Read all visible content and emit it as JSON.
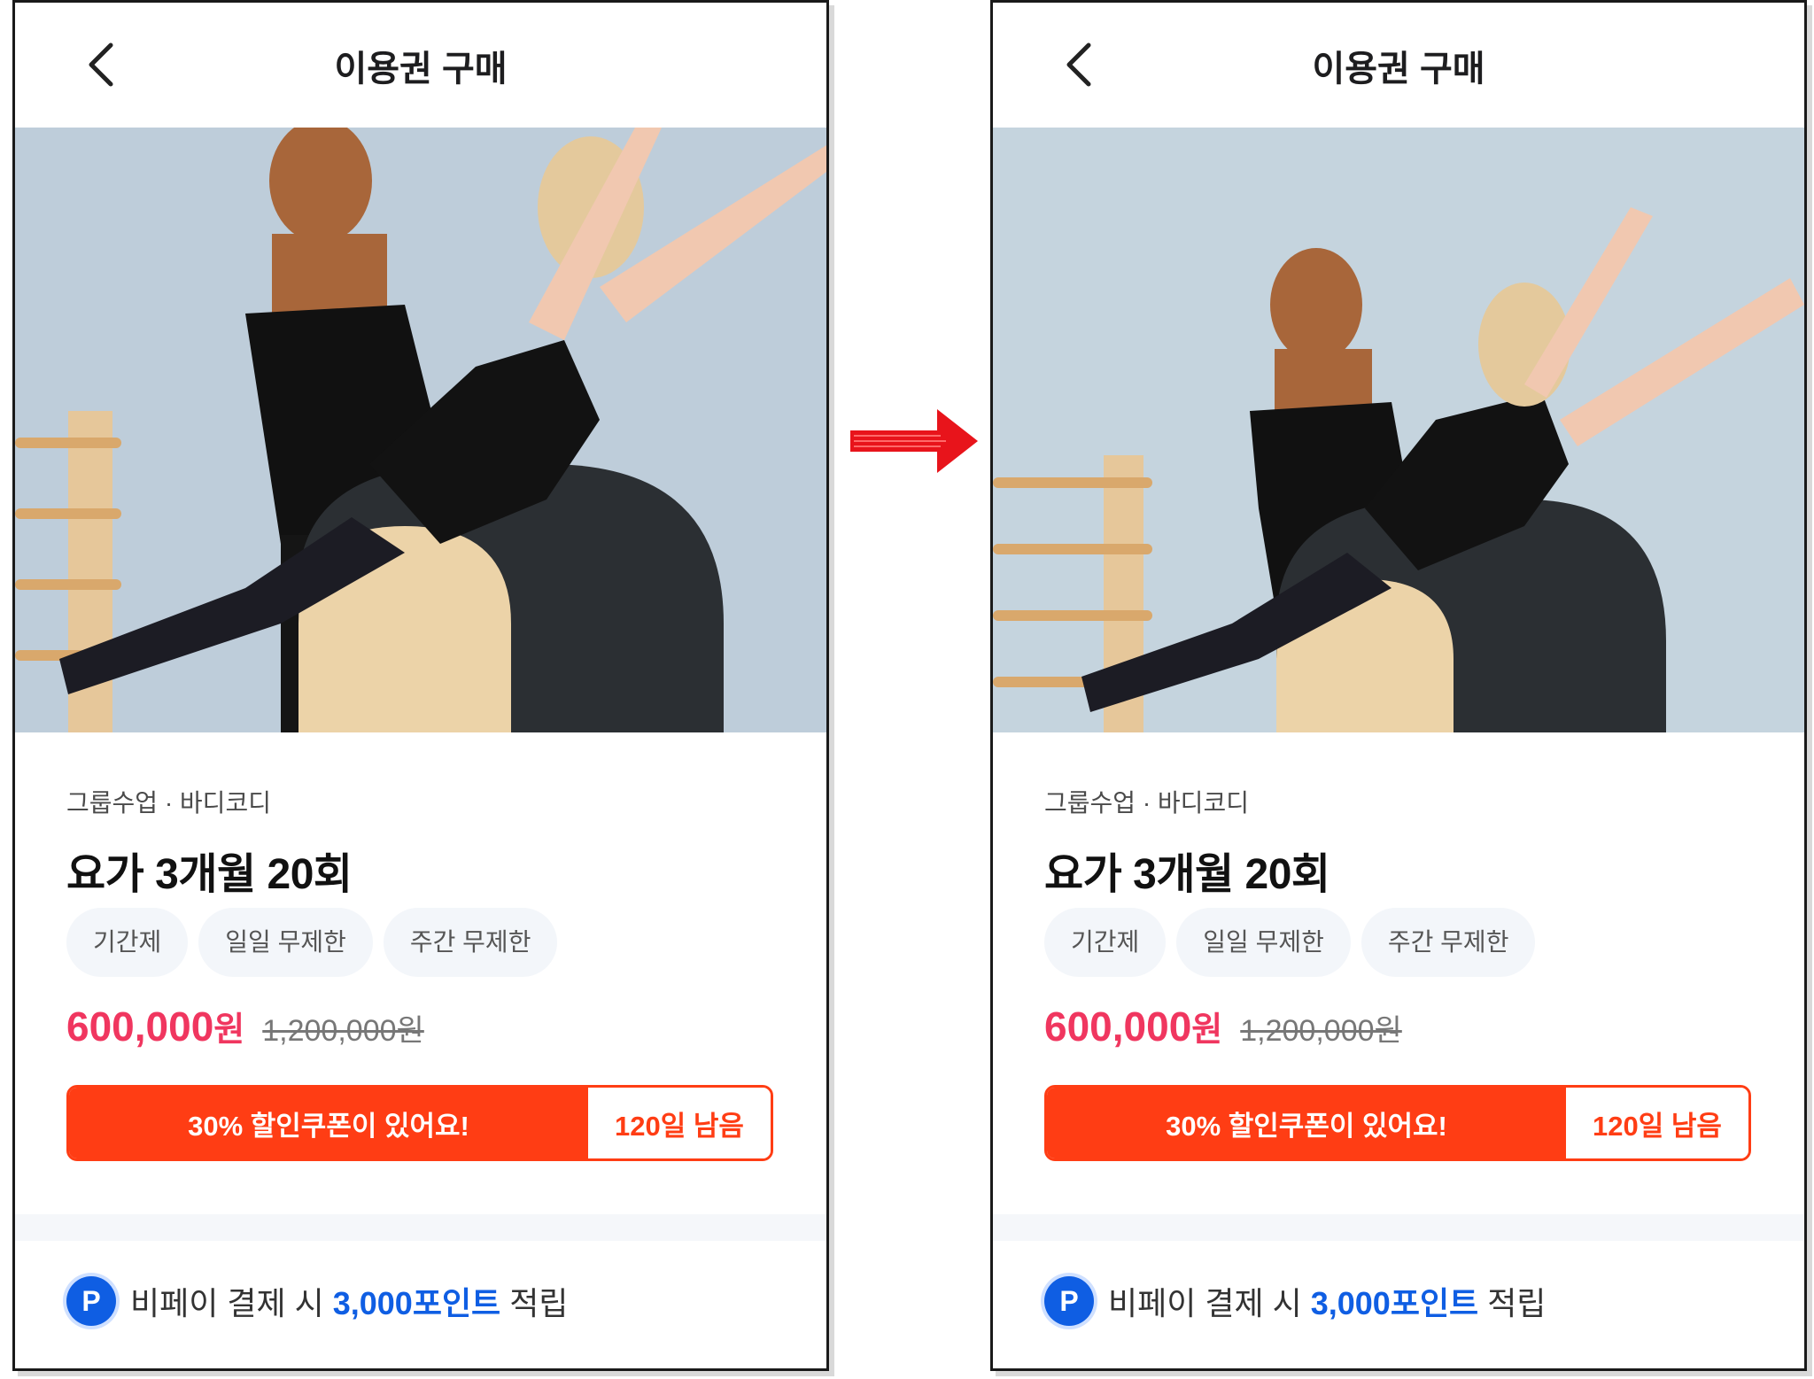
{
  "screens": [
    {
      "id": "before",
      "header": {
        "title": "이용권 구매"
      },
      "product": {
        "meta": "그룹수업 · 바디코디",
        "title": "요가 3개월 20회",
        "tags": [
          "기간제",
          "일일 무제한",
          "주간 무제한"
        ],
        "price_now": "600,000",
        "price_unit": "원",
        "price_old": "1,200,000원"
      },
      "coupon": {
        "label": "30% 할인쿠폰이 있어요!",
        "days_left": "120일 남음"
      },
      "points": {
        "badge": "P",
        "prefix": "비페이 결제 시 ",
        "amount": "3,000포인트",
        "suffix": " 적립"
      }
    },
    {
      "id": "after",
      "header": {
        "title": "이용권 구매"
      },
      "product": {
        "meta": "그룹수업 · 바디코디",
        "title": "요가 3개월 20회",
        "tags": [
          "기간제",
          "일일 무제한",
          "주간 무제한"
        ],
        "price_now": "600,000",
        "price_unit": "원",
        "price_old": "1,200,000원"
      },
      "coupon": {
        "label": "30% 할인쿠폰이 있어요!",
        "days_left": "120일 남음"
      },
      "points": {
        "badge": "P",
        "prefix": "비페이 결제 시 ",
        "amount": "3,000포인트",
        "suffix": " 적립"
      }
    }
  ],
  "colors": {
    "accent_red": "#f0365f",
    "coupon_orange": "#ff3d14",
    "point_blue": "#0f5ee3",
    "arrow_red": "#e8141b"
  },
  "icons": {
    "back": "chevron-left-icon",
    "transition": "red-arrow-icon",
    "point": "p-coin-icon"
  }
}
